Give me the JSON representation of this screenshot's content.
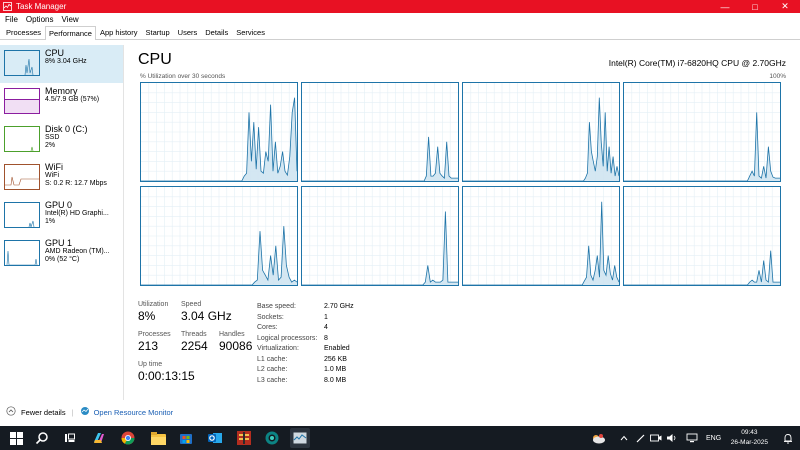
{
  "window": {
    "title": "Task Manager"
  },
  "menu": [
    "File",
    "Options",
    "View"
  ],
  "tabs": [
    "Processes",
    "Performance",
    "App history",
    "Startup",
    "Users",
    "Details",
    "Services"
  ],
  "sidebar": [
    {
      "title": "CPU",
      "line1": "8% 3.04 GHz",
      "line2": "",
      "color": "#1e74a8"
    },
    {
      "title": "Memory",
      "line1": "4.5/7.9 GB (57%)",
      "line2": "",
      "color": "#8b1d9f"
    },
    {
      "title": "Disk 0 (C:)",
      "line1": "SSD",
      "line2": "2%",
      "color": "#4ca02c"
    },
    {
      "title": "WiFi",
      "line1": "WiFi",
      "line2": "S: 0.2  R: 12.7 Mbps",
      "color": "#a0522d"
    },
    {
      "title": "GPU 0",
      "line1": "Intel(R) HD Graphi...",
      "line2": "1%",
      "color": "#1e74a8"
    },
    {
      "title": "GPU 1",
      "line1": "AMD Radeon (TM)...",
      "line2": "0% (52 °C)",
      "color": "#1e74a8"
    }
  ],
  "main": {
    "title": "CPU",
    "model": "Intel(R) Core(TM) i7-6820HQ CPU @ 2.70GHz",
    "util_caption": "% Utilization over 30 seconds",
    "util_max": "100%"
  },
  "cores": [
    [
      0,
      0,
      0,
      0,
      0,
      0,
      0,
      0,
      0,
      0,
      0,
      0,
      0,
      0,
      0,
      0,
      0,
      0,
      0,
      0,
      0,
      0,
      0,
      0,
      0,
      0,
      0,
      0,
      0,
      0,
      0,
      0,
      0,
      0,
      0,
      0,
      0,
      0,
      0,
      0,
      0,
      0,
      0,
      5,
      8,
      70,
      20,
      60,
      12,
      55,
      10,
      8,
      30,
      20,
      78,
      10,
      40,
      8,
      15,
      30,
      10,
      6,
      25,
      70,
      85,
      10
    ],
    [
      0,
      0,
      0,
      0,
      0,
      0,
      0,
      0,
      0,
      0,
      0,
      0,
      0,
      0,
      0,
      0,
      0,
      0,
      0,
      0,
      0,
      0,
      0,
      0,
      0,
      0,
      0,
      0,
      0,
      0,
      0,
      0,
      0,
      0,
      0,
      0,
      0,
      0,
      0,
      0,
      0,
      0,
      0,
      0,
      0,
      0,
      0,
      0,
      0,
      0,
      0,
      0,
      0,
      0,
      0,
      5,
      45,
      5,
      5,
      8,
      35,
      8,
      5,
      3,
      40,
      5,
      3,
      3,
      3,
      3
    ],
    [
      0,
      0,
      0,
      0,
      0,
      0,
      0,
      0,
      0,
      0,
      0,
      0,
      0,
      0,
      0,
      0,
      0,
      0,
      0,
      0,
      0,
      0,
      0,
      0,
      0,
      0,
      0,
      0,
      0,
      0,
      0,
      0,
      0,
      0,
      0,
      0,
      0,
      0,
      0,
      0,
      0,
      0,
      0,
      0,
      0,
      0,
      0,
      0,
      0,
      0,
      0,
      0,
      0,
      0,
      0,
      0,
      0,
      0,
      0,
      0,
      0,
      0,
      3,
      8,
      60,
      30,
      20,
      10,
      25,
      85,
      40,
      15,
      70,
      10,
      35,
      8,
      25,
      5,
      15,
      5
    ],
    [
      0,
      0,
      0,
      0,
      0,
      0,
      0,
      0,
      0,
      0,
      0,
      0,
      0,
      0,
      0,
      0,
      0,
      0,
      0,
      0,
      0,
      0,
      0,
      0,
      0,
      0,
      0,
      0,
      0,
      0,
      0,
      0,
      0,
      0,
      0,
      0,
      0,
      0,
      0,
      0,
      0,
      0,
      0,
      0,
      0,
      0,
      0,
      0,
      0,
      0,
      0,
      0,
      0,
      0,
      5,
      10,
      5,
      70,
      5,
      3,
      15,
      3,
      35,
      10,
      4,
      3,
      3,
      3
    ],
    [
      0,
      0,
      0,
      0,
      0,
      0,
      0,
      0,
      0,
      0,
      0,
      0,
      0,
      0,
      0,
      0,
      0,
      0,
      0,
      0,
      0,
      0,
      0,
      0,
      0,
      0,
      0,
      0,
      0,
      0,
      0,
      0,
      0,
      0,
      0,
      0,
      0,
      0,
      0,
      0,
      0,
      0,
      0,
      3,
      5,
      55,
      15,
      10,
      5,
      30,
      10,
      40,
      5,
      8,
      60,
      20,
      8,
      3,
      5,
      3
    ],
    [
      0,
      0,
      0,
      0,
      0,
      0,
      0,
      0,
      0,
      0,
      0,
      0,
      0,
      0,
      0,
      0,
      0,
      0,
      0,
      0,
      0,
      0,
      0,
      0,
      0,
      0,
      0,
      0,
      0,
      0,
      0,
      0,
      0,
      0,
      0,
      0,
      0,
      0,
      0,
      0,
      0,
      0,
      0,
      0,
      0,
      0,
      0,
      0,
      0,
      3,
      20,
      3,
      5,
      3,
      3,
      3,
      5,
      75,
      3,
      3,
      3,
      3,
      3
    ],
    [
      0,
      0,
      0,
      0,
      0,
      0,
      0,
      0,
      0,
      0,
      0,
      0,
      0,
      0,
      0,
      0,
      0,
      0,
      0,
      0,
      0,
      0,
      0,
      0,
      0,
      0,
      0,
      0,
      0,
      0,
      0,
      0,
      0,
      0,
      0,
      0,
      0,
      0,
      0,
      0,
      0,
      0,
      0,
      0,
      0,
      0,
      0,
      0,
      0,
      0,
      0,
      0,
      0,
      0,
      0,
      0,
      4,
      8,
      40,
      10,
      5,
      15,
      30,
      8,
      85,
      15,
      10,
      30,
      12,
      5,
      20,
      8,
      3
    ],
    [
      0,
      0,
      0,
      0,
      0,
      0,
      0,
      0,
      0,
      0,
      0,
      0,
      0,
      0,
      0,
      0,
      0,
      0,
      0,
      0,
      0,
      0,
      0,
      0,
      0,
      0,
      0,
      0,
      0,
      0,
      0,
      0,
      0,
      0,
      0,
      0,
      0,
      0,
      0,
      0,
      0,
      0,
      0,
      0,
      0,
      0,
      0,
      0,
      0,
      0,
      0,
      0,
      0,
      0,
      3,
      5,
      3,
      3,
      15,
      3,
      25,
      5,
      3,
      35,
      3,
      3,
      3,
      3
    ]
  ],
  "stats": {
    "utilization": {
      "label": "Utilization",
      "value": "8%"
    },
    "speed": {
      "label": "Speed",
      "value": "3.04 GHz"
    },
    "processes": {
      "label": "Processes",
      "value": "213"
    },
    "threads": {
      "label": "Threads",
      "value": "2254"
    },
    "handles": {
      "label": "Handles",
      "value": "90086"
    },
    "uptime": {
      "label": "Up time",
      "value": "0:00:13:15"
    }
  },
  "specs": [
    {
      "k": "Base speed:",
      "v": "2.70 GHz"
    },
    {
      "k": "Sockets:",
      "v": "1"
    },
    {
      "k": "Cores:",
      "v": "4"
    },
    {
      "k": "Logical processors:",
      "v": "8"
    },
    {
      "k": "Virtualization:",
      "v": "Enabled"
    },
    {
      "k": "L1 cache:",
      "v": "256 KB"
    },
    {
      "k": "L2 cache:",
      "v": "1.0 MB"
    },
    {
      "k": "L3 cache:",
      "v": "8.0 MB"
    }
  ],
  "footer": {
    "fewer_details": "Fewer details",
    "open_monitor": "Open Resource Monitor"
  },
  "taskbar": {
    "lang": "ENG",
    "time": "09:43",
    "date": "26-Mar-2025"
  },
  "colors": {
    "accent": "#1e74a8",
    "titlebar": "#e81123",
    "taskbar": "#151b22"
  }
}
